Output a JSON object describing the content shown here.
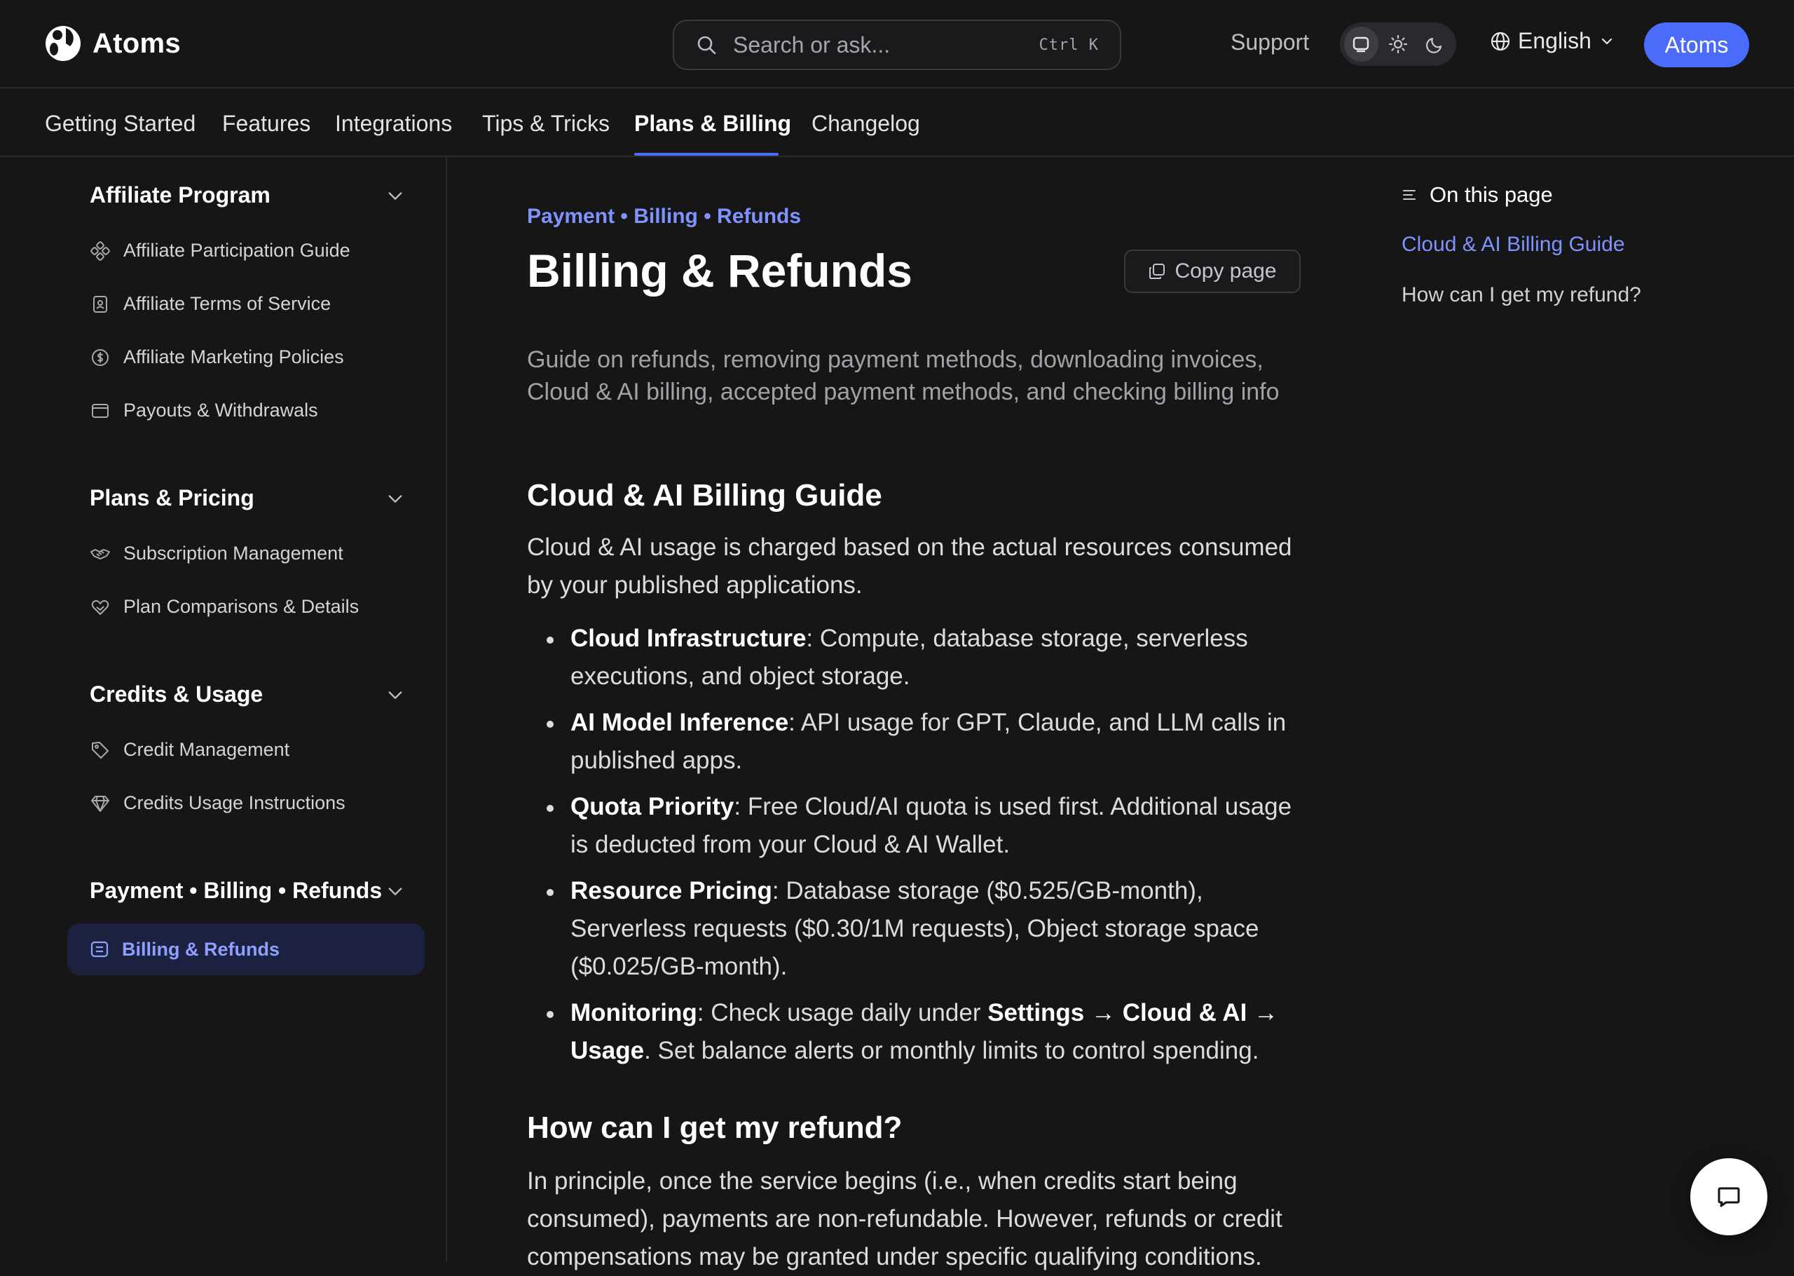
{
  "header": {
    "brand": "Atoms",
    "search": {
      "placeholder": "Search or ask...",
      "shortcut": "Ctrl K"
    },
    "support_label": "Support",
    "theme_modes": [
      "system",
      "light",
      "dark"
    ],
    "language": "English",
    "cta_label": "Atoms",
    "accent_color": "#4b6bfb"
  },
  "tabs": [
    {
      "label": "Getting Started"
    },
    {
      "label": "Features"
    },
    {
      "label": "Integrations"
    },
    {
      "label": "Tips & Tricks"
    },
    {
      "label": "Plans & Billing",
      "active": true
    },
    {
      "label": "Changelog"
    }
  ],
  "sidebar": {
    "groups": [
      {
        "title": "Affiliate Program",
        "items": [
          {
            "label": "Affiliate Participation Guide",
            "icon": "network-icon"
          },
          {
            "label": "Affiliate Terms of Service",
            "icon": "document-icon"
          },
          {
            "label": "Affiliate Marketing Policies",
            "icon": "dollar-icon"
          },
          {
            "label": "Payouts & Withdrawals",
            "icon": "wallet-icon"
          }
        ]
      },
      {
        "title": "Plans & Pricing",
        "items": [
          {
            "label": "Subscription Management",
            "icon": "handshake-icon"
          },
          {
            "label": "Plan Comparisons & Details",
            "icon": "heart-icon"
          }
        ]
      },
      {
        "title": "Credits & Usage",
        "items": [
          {
            "label": "Credit Management",
            "icon": "tag-icon"
          },
          {
            "label": "Credits Usage Instructions",
            "icon": "diamond-icon"
          }
        ]
      },
      {
        "title": "Payment • Billing • Refunds",
        "items": [
          {
            "label": "Billing & Refunds",
            "icon": "receipt-icon",
            "active": true
          }
        ]
      }
    ]
  },
  "main": {
    "breadcrumb": "Payment • Billing • Refunds",
    "title": "Billing & Refunds",
    "copy_label": "Copy page",
    "lead": "Guide on refunds, removing payment methods, downloading invoices, Cloud & AI billing, accepted payment methods, and checking billing info",
    "section1": {
      "heading": "Cloud & AI Billing Guide",
      "intro": "Cloud & AI usage is charged based on the actual resources consumed by your published applications.",
      "bullets": [
        {
          "term": "Cloud Infrastructure",
          "text": ": Compute, database storage, serverless executions, and object storage."
        },
        {
          "term": "AI Model Inference",
          "text": ": API usage for GPT, Claude, and LLM calls in published apps."
        },
        {
          "term": "Quota Priority",
          "text": ": Free Cloud/AI quota is used first. Additional usage is deducted from your Cloud & AI Wallet."
        },
        {
          "term": "Resource Pricing",
          "text": ": Database storage ($0.525/GB-month), Serverless requests ($0.30/1M requests), Object storage space ($0.025/GB-month)."
        }
      ],
      "monitoring": {
        "term": "Monitoring",
        "pre": ": Check usage daily under ",
        "path1": "Settings",
        "arrow": " → ",
        "path2": "Cloud & AI",
        "path3": "Usage",
        "post": ". Set balance alerts or monthly limits to control spending."
      }
    },
    "section2": {
      "heading": "How can I get my refund?",
      "text": "In principle, once the service begins (i.e., when credits start being consumed), payments are non-refundable. However, refunds or credit compensations may be granted under specific qualifying conditions."
    }
  },
  "toc": {
    "heading": "On this page",
    "links": [
      {
        "label": "Cloud & AI Billing Guide",
        "active": true
      },
      {
        "label": "How can I get my refund?"
      }
    ]
  }
}
